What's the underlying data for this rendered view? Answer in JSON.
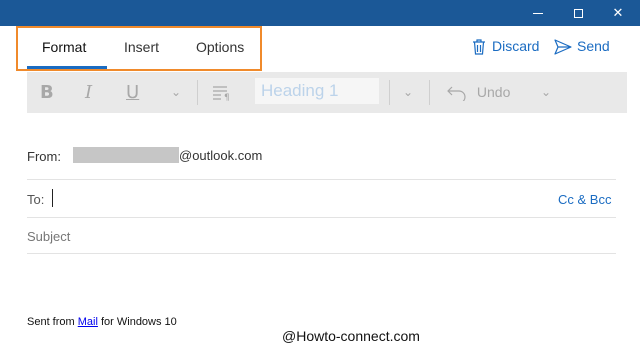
{
  "tabs": [
    {
      "label": "Format",
      "selected": true
    },
    {
      "label": "Insert",
      "selected": false
    },
    {
      "label": "Options",
      "selected": false
    }
  ],
  "commands": {
    "discard_label": "Discard",
    "send_label": "Send"
  },
  "toolbar": {
    "bold_glyph": "B",
    "italic_glyph": "I",
    "underline_glyph": "U",
    "style_value": "Heading 1",
    "undo_label": "Undo"
  },
  "compose": {
    "from_label": "From:",
    "from_domain": "@outlook.com",
    "to_label": "To:",
    "cc_bcc_label": "Cc & Bcc",
    "subject_placeholder": "Subject"
  },
  "body": {
    "signature_prefix": "Sent from ",
    "signature_link": "Mail",
    "signature_suffix": " for Windows 10"
  },
  "watermark": "@Howto-connect.com",
  "colors": {
    "title_bar": "#1b5897",
    "accent": "#1b6cc2",
    "highlight_box": "#f08a2b"
  }
}
